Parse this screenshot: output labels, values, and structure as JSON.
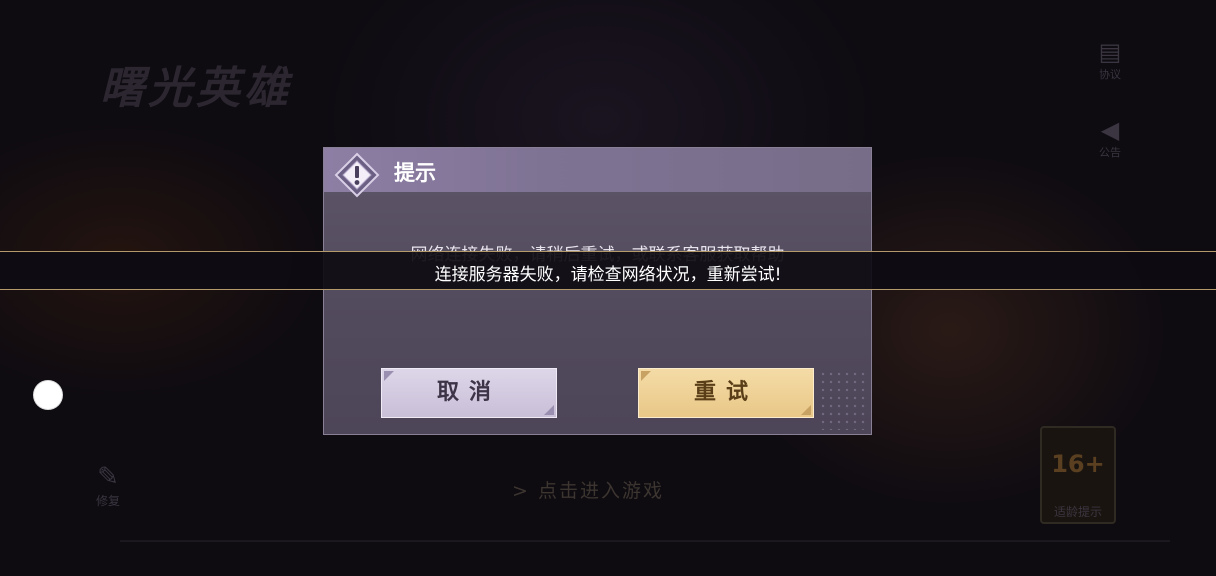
{
  "background": {
    "game_logo_text": "曙光英雄",
    "side_buttons": [
      {
        "label": "协议",
        "icon": "document-icon"
      },
      {
        "label": "公告",
        "icon": "megaphone-icon"
      }
    ],
    "repair_label": "修复",
    "enter_game_hint": "> 点击进入游戏",
    "age_rating": {
      "number": "16+",
      "label": "适龄提示"
    }
  },
  "dialog": {
    "title": "提示",
    "message": "网络连接失败，请稍后重试，或联系客服获取帮助",
    "cancel_label": "取消",
    "retry_label": "重试"
  },
  "toast": {
    "text": "连接服务器失败，请检查网络状况，重新尝试!"
  },
  "colors": {
    "dialog_header": "#8d7ea4",
    "retry_button": "#f0d398",
    "cancel_button": "#d6cee3",
    "toast_border": "#b49a6a"
  }
}
